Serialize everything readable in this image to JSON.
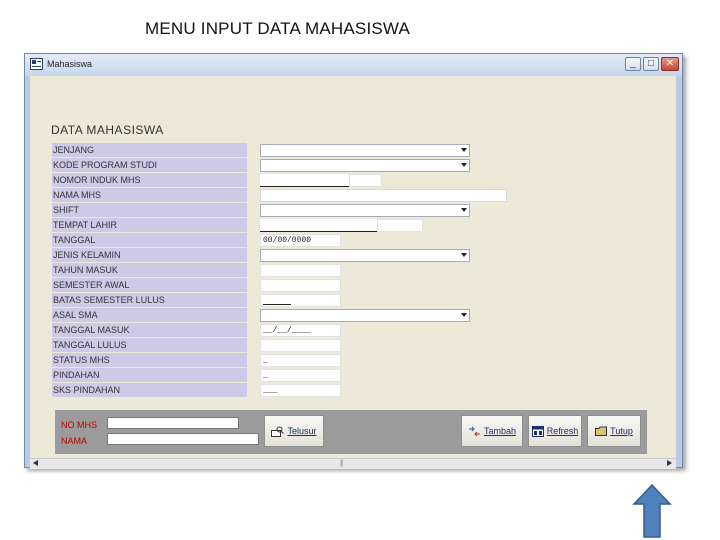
{
  "slide": {
    "title": "MENU INPUT DATA MAHASISWA"
  },
  "window": {
    "title": "Mahasiswa",
    "minimize": "_",
    "maximize": "□",
    "close": "✕"
  },
  "form": {
    "section_title": "DATA MAHASISWA",
    "fields": [
      {
        "label": "JENJANG",
        "type": "combo"
      },
      {
        "label": "KODE PROGRAM STUDI",
        "type": "combo"
      },
      {
        "label": "NOMOR INDUK MHS",
        "type": "text",
        "value": ""
      },
      {
        "label": "NAMA MHS",
        "type": "text",
        "value": ""
      },
      {
        "label": "SHIFT",
        "type": "combo"
      },
      {
        "label": "TEMPAT LAHIR",
        "type": "text",
        "value": ""
      },
      {
        "label": "TANGGAL",
        "type": "masked",
        "value": "00/00/0000"
      },
      {
        "label": "JENIS KELAMIN",
        "type": "combo"
      },
      {
        "label": "TAHUN MASUK",
        "type": "text",
        "value": ""
      },
      {
        "label": "SEMESTER AWAL",
        "type": "text",
        "value": ""
      },
      {
        "label": "BATAS SEMESTER LULUS",
        "type": "text",
        "value": ""
      },
      {
        "label": "ASAL SMA",
        "type": "combo"
      },
      {
        "label": "TANGGAL MASUK",
        "type": "masked",
        "value": "__/__/____"
      },
      {
        "label": "TANGGAL LULUS",
        "type": "text",
        "value": ""
      },
      {
        "label": "STATUS MHS",
        "type": "text",
        "value": "_"
      },
      {
        "label": "PINDAHAN",
        "type": "text",
        "value": "_"
      },
      {
        "label": "SKS PINDAHAN",
        "type": "text",
        "value": "___"
      }
    ]
  },
  "search": {
    "nomhs_label": "NO MHS",
    "nama_label": "NAMA",
    "nomhs_value": "",
    "nama_value": "",
    "telusur_label": "Telusur"
  },
  "buttons": {
    "tambah": "Tambah",
    "refresh": "Refresh",
    "tutup": "Tutup"
  },
  "icons": {
    "app": "form-icon",
    "telusur": "search-icon",
    "tambah": "add-icon",
    "refresh": "refresh-icon",
    "tutup": "folder-icon",
    "slide_arrow": "up-arrow-icon"
  },
  "colors": {
    "label_bg": "#cfc9e8",
    "client_bg": "#ece9d8",
    "bottom_panel": "#9b9b9b",
    "search_label": "#c00000",
    "arrow_fill": "#4f81bd"
  }
}
